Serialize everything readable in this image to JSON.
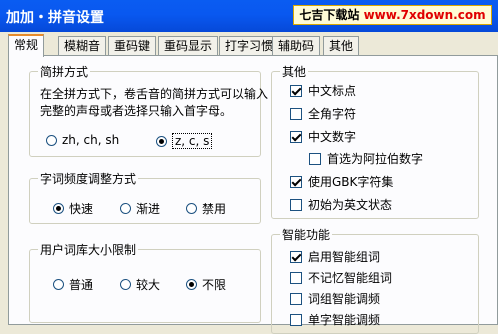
{
  "window": {
    "title": "加加・拼音设置"
  },
  "watermark": {
    "prefix": "七吉下载站 ",
    "url": "www.7xdown.com"
  },
  "tabs": [
    "常规",
    "模糊音",
    "重码键",
    "重码显示",
    "打字习惯",
    "辅助码",
    "其他"
  ],
  "pinyin_mode": {
    "title": "简拼方式",
    "description": "在全拼方式下，卷舌音的简拼方式可以输入完整的声母或者选择只输入首字母。",
    "options": [
      "zh, ch, sh",
      "z, c, s"
    ],
    "selected": "z, c, s"
  },
  "freq_adjust": {
    "title": "字词频度调整方式",
    "options": [
      "快速",
      "渐进",
      "禁用"
    ],
    "selected": "快速"
  },
  "user_dict": {
    "title": "用户词库大小限制",
    "options": [
      "普通",
      "较大",
      "不限"
    ],
    "selected": "不限"
  },
  "other": {
    "title": "其他",
    "items": [
      {
        "label": "中文标点",
        "checked": true
      },
      {
        "label": "全角字符",
        "checked": false
      },
      {
        "label": "中文数字",
        "checked": true
      },
      {
        "label": "首选为阿拉伯数字",
        "checked": false
      },
      {
        "label": "使用GBK字符集",
        "checked": true
      },
      {
        "label": "初始为英文状态",
        "checked": false
      }
    ]
  },
  "smart": {
    "title": "智能功能",
    "items": [
      {
        "label": "启用智能组词",
        "checked": true
      },
      {
        "label": "不记忆智能组词",
        "checked": false
      },
      {
        "label": "词组智能调频",
        "checked": false
      },
      {
        "label": "单字智能调频",
        "checked": false
      }
    ]
  }
}
